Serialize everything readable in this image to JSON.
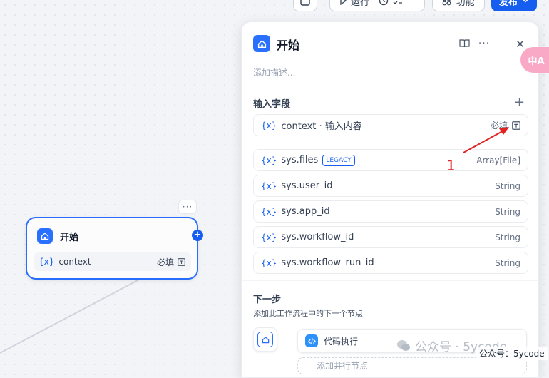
{
  "toolbar": {
    "run_label": "运行",
    "features_label": "功能",
    "publish_label": "发布"
  },
  "canvas_node": {
    "title": "开始",
    "var_name": "context",
    "required": "必填",
    "more": "···"
  },
  "panel": {
    "title": "开始",
    "description_placeholder": "添加描述...",
    "input_section_title": "输入字段",
    "fields": [
      {
        "name": "context · 输入内容",
        "right": "必填"
      },
      {
        "name": "sys.files",
        "badge": "LEGACY",
        "right": "Array[File]"
      },
      {
        "name": "sys.user_id",
        "right": "String"
      },
      {
        "name": "sys.app_id",
        "right": "String"
      },
      {
        "name": "sys.workflow_id",
        "right": "String"
      },
      {
        "name": "sys.workflow_run_id",
        "right": "String"
      }
    ],
    "var_glyph": "{x}",
    "next_title": "下一步",
    "next_desc": "添加此工作流程中的下一个节点",
    "next_node": "代码执行",
    "next_add": "添加并行节点"
  },
  "float_button": "中A",
  "annotation": {
    "label": "1",
    "color": "#e02424"
  },
  "watermark": {
    "text": "公众号 · 5ycode",
    "sub": "公众号：5ycode"
  },
  "colors": {
    "accent": "#155eef",
    "node_icon": "#2970ff"
  }
}
